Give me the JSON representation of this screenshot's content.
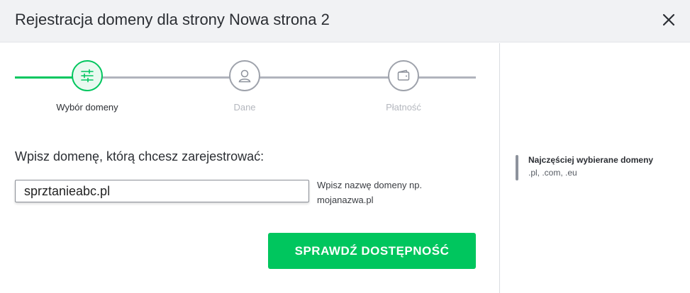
{
  "header": {
    "title": "Rejestracja domeny dla strony Nowa strona 2"
  },
  "steps": [
    {
      "label": "Wybór domeny",
      "icon": "sliders-icon",
      "state": "active"
    },
    {
      "label": "Dane",
      "icon": "user-icon",
      "state": "pending"
    },
    {
      "label": "Płatność",
      "icon": "wallet-icon",
      "state": "pending"
    }
  ],
  "form": {
    "prompt": "Wpisz domenę, którą chcesz zarejestrować:",
    "domain_value": "sprztanieabc.pl",
    "hint": "Wpisz nazwę domeny np. mojanazwa.pl",
    "button_label": "SPRAWDŹ DOSTĘPNOŚĆ"
  },
  "sidebar": {
    "title": "Najczęściej wybierane domeny",
    "text": ".pl, .com, .eu"
  },
  "colors": {
    "accent": "#00c65e",
    "header_bg": "#f1f2f4",
    "inactive": "#b1b4bd"
  }
}
